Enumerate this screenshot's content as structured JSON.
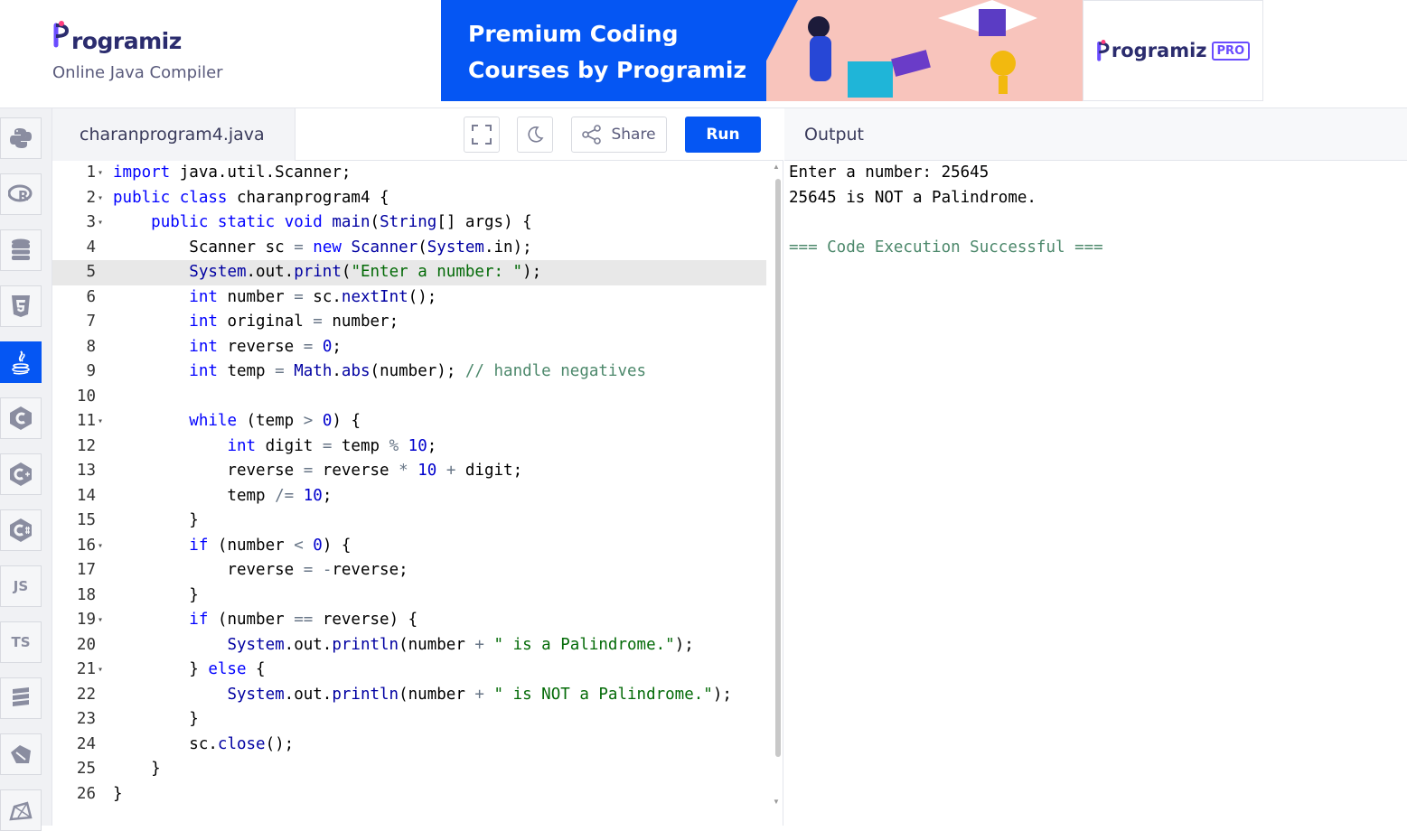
{
  "header": {
    "logo_text": "rogramiz",
    "subtitle": "Online Java Compiler"
  },
  "banner": {
    "line1": "Premium Coding",
    "line2": "Courses by Programiz",
    "pro_logo": "rogramiz",
    "pro_badge": "PRO"
  },
  "sidebar": {
    "items": [
      {
        "name": "python",
        "label": "",
        "icon": "python-icon"
      },
      {
        "name": "r",
        "label": "",
        "icon": "r-icon"
      },
      {
        "name": "sql",
        "label": "",
        "icon": "database-icon"
      },
      {
        "name": "html",
        "label": "",
        "icon": "html5-icon"
      },
      {
        "name": "java",
        "label": "",
        "icon": "java-icon",
        "active": true
      },
      {
        "name": "c",
        "label": "",
        "icon": "c-icon"
      },
      {
        "name": "cpp",
        "label": "",
        "icon": "cpp-icon"
      },
      {
        "name": "csharp",
        "label": "",
        "icon": "csharp-icon"
      },
      {
        "name": "js",
        "label": "JS",
        "icon": "js-icon"
      },
      {
        "name": "ts",
        "label": "TS",
        "icon": "ts-icon"
      },
      {
        "name": "go",
        "label": "",
        "icon": "go-icon"
      },
      {
        "name": "swift",
        "label": "",
        "icon": "swift-icon"
      },
      {
        "name": "kotlin",
        "label": "",
        "icon": "kotlin-icon"
      }
    ]
  },
  "editor": {
    "filename": "charanprogram4.java",
    "share_label": "Share",
    "run_label": "Run",
    "active_line": 5
  },
  "output": {
    "title": "Output",
    "lines": [
      "Enter a number: 25645",
      "25645 is NOT a Palindrome.",
      "",
      "=== Code Execution Successful ==="
    ]
  },
  "colors": {
    "accent": "#0556f3",
    "keyword": "#0000ff",
    "string": "#036a07",
    "comment": "#4c886b"
  }
}
